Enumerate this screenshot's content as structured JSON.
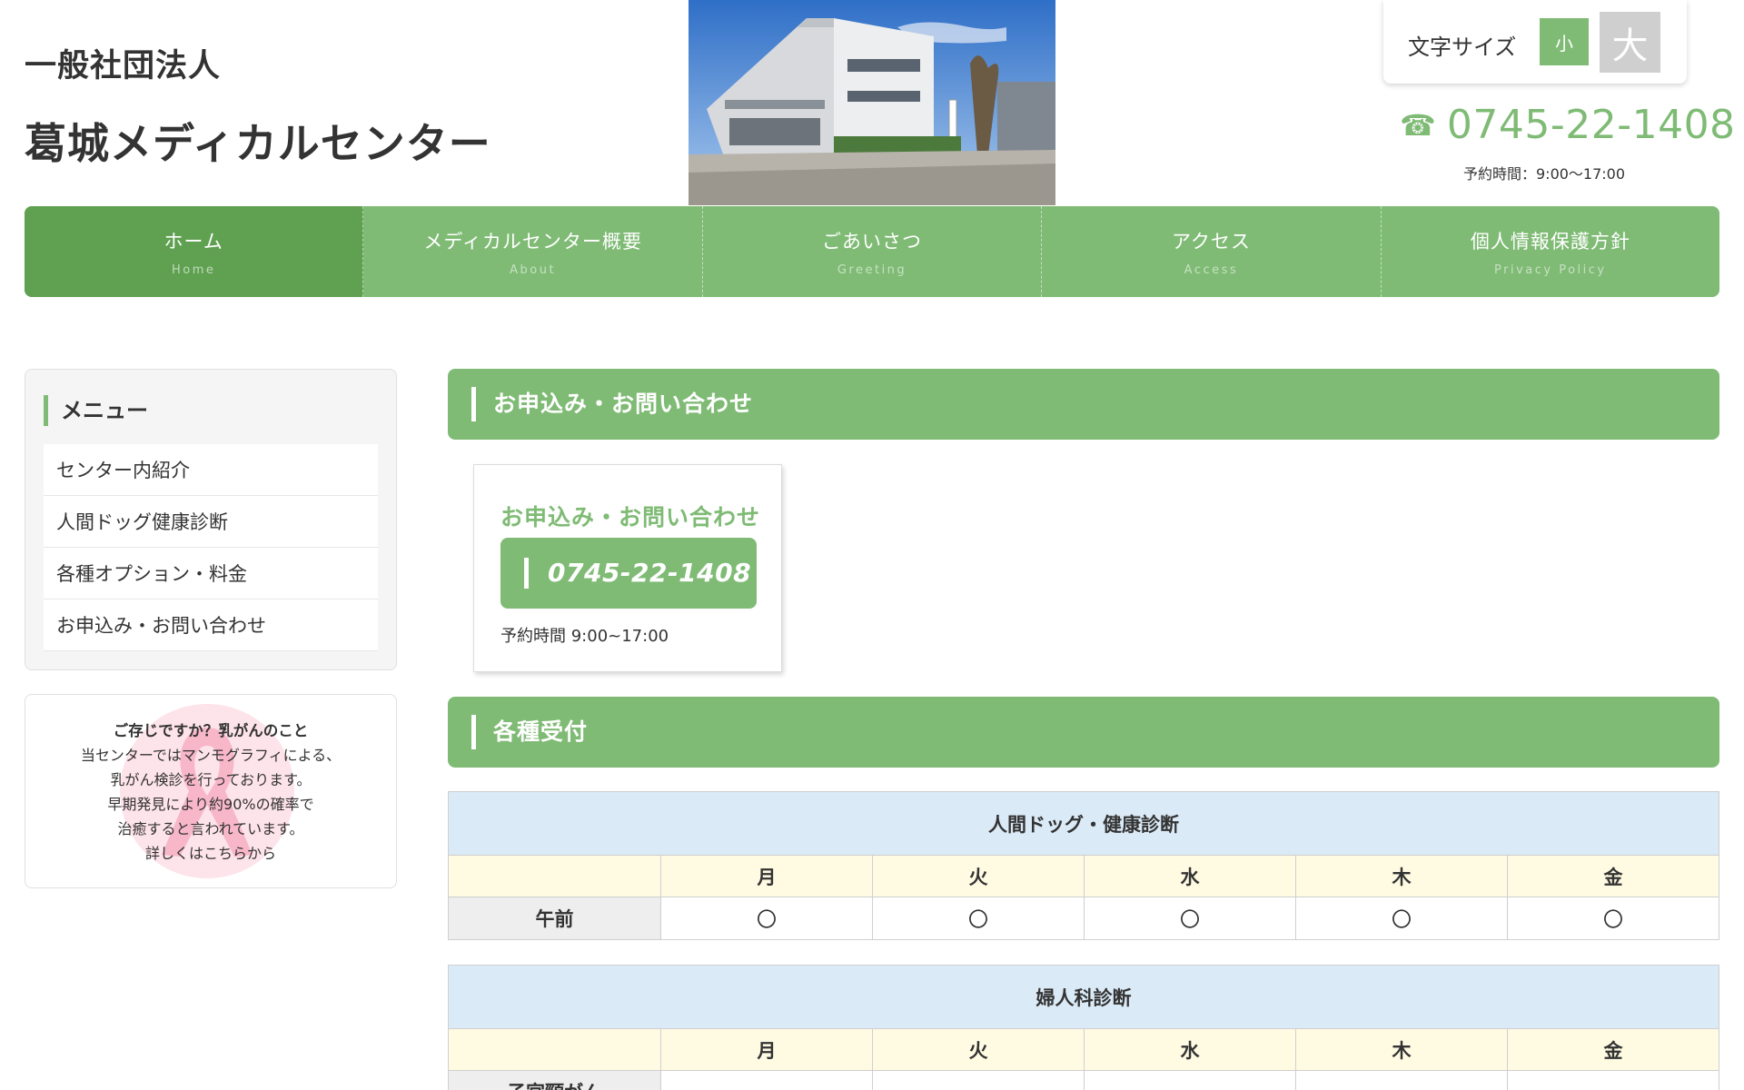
{
  "header": {
    "org_name": "一般社団法人",
    "site_title": "葛城メディカルセンター",
    "font_size": {
      "label": "文字サイズ",
      "small": "小",
      "large": "大"
    },
    "tel": {
      "icon": "☎",
      "number": "0745-22-1408",
      "hours": "予約時間：9:00〜17:00"
    }
  },
  "nav": [
    {
      "ja": "ホーム",
      "en": "Home",
      "active": true
    },
    {
      "ja": "メディカルセンター概要",
      "en": "About"
    },
    {
      "ja": "ごあいさつ",
      "en": "Greeting"
    },
    {
      "ja": "アクセス",
      "en": "Access"
    },
    {
      "ja": "個人情報保護方針",
      "en": "Privacy Policy"
    }
  ],
  "sidebar": {
    "title": "メニュー",
    "items": [
      "センター内紹介",
      "人間ドッグ健康診断",
      "各種オプション・料金",
      "お申込み・お問い合わせ"
    ],
    "banner": {
      "title": "ご存じですか？乳がんのこと",
      "lines": [
        "当センターではマンモグラフィによる、",
        "乳がん検診を行っております。",
        "早期発見により約90%の確率で",
        "治癒すると言われています。",
        "詳しくはこちらから"
      ]
    }
  },
  "main": {
    "contact_heading": "お申込み・お問い合わせ",
    "contact_card": {
      "title": "お申込み・お問い合わせ",
      "number": "0745-22-1408",
      "hours": "予約時間 9:00~17:00"
    },
    "reception_heading": "各種受付",
    "schedule1": {
      "title": "人間ドッグ・健康診断",
      "days": [
        "月",
        "火",
        "水",
        "木",
        "金"
      ],
      "rows": [
        {
          "label": "午前",
          "cells": [
            "〇",
            "〇",
            "〇",
            "〇",
            "〇"
          ]
        }
      ]
    },
    "schedule2": {
      "title": "婦人科診断",
      "days": [
        "月",
        "火",
        "水",
        "木",
        "金"
      ],
      "rows": [
        {
          "label": "子宮頸がん",
          "cells": [
            "",
            "",
            "",
            "",
            ""
          ]
        }
      ]
    }
  },
  "colors": {
    "accent": "#7fbb75",
    "accent_dark": "#5fa151",
    "table_head": "#dbeaf7",
    "table_days": "#fffbe3"
  }
}
